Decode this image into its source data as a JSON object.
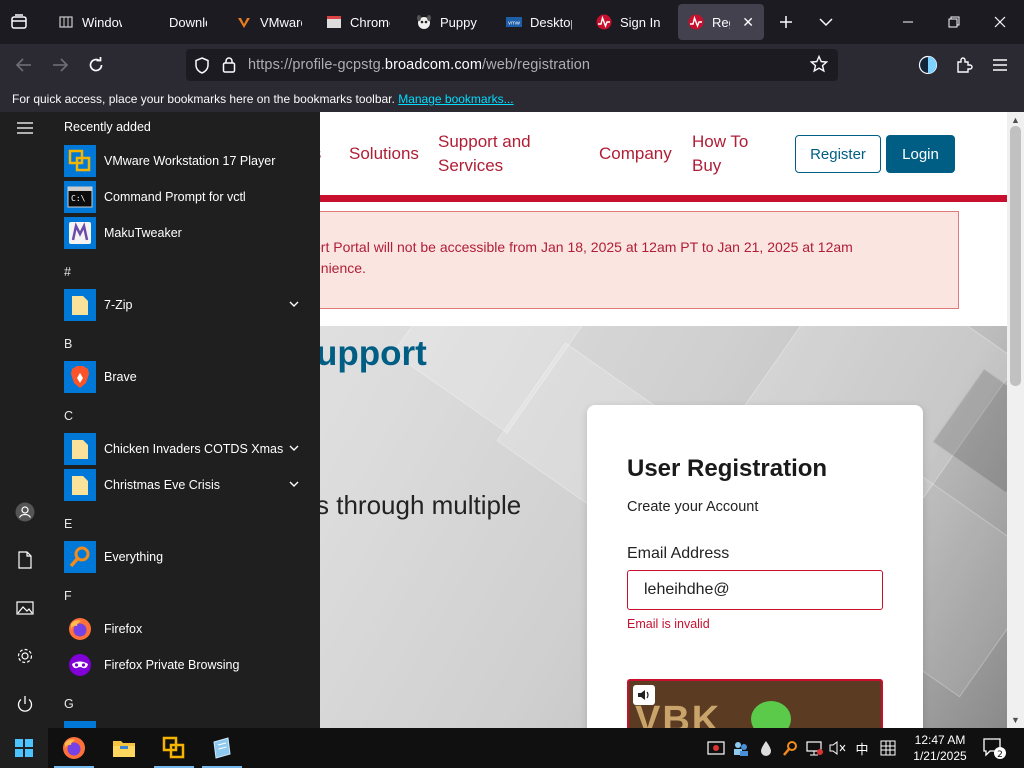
{
  "browser": {
    "tabs": [
      {
        "title": "Window",
        "fav": "windows-icon"
      },
      {
        "title": "Downlo",
        "fav": "download-icon"
      },
      {
        "title": "VMware",
        "fav": "vmware-icon"
      },
      {
        "title": "Chrome",
        "fav": "chrome-icon"
      },
      {
        "title": "Puppy",
        "fav": "puppy-icon"
      },
      {
        "title": "Desktop",
        "fav": "vmware-desktop-icon"
      },
      {
        "title": "Sign In",
        "fav": "broadcom-icon"
      },
      {
        "title": "Regist",
        "fav": "broadcom-icon",
        "active": true
      }
    ],
    "url_prefix": "https://profile-gcpstg.",
    "url_domain": "broadcom.com",
    "url_path": "/web/registration",
    "bookmarks_text": "For quick access, place your bookmarks here on the bookmarks toolbar.",
    "bookmarks_link": "Manage bookmarks..."
  },
  "site": {
    "nav": {
      "partial": "ts",
      "solutions": "Solutions",
      "support_1": "Support and",
      "support_2": "Services",
      "company": "Company",
      "howto_1": "How To",
      "howto_2": "Buy",
      "register": "Register",
      "login": "Login"
    },
    "alert_line1": "ort Portal will not be accessible from Jan 18, 2025 at 12am PT to Jan 21, 2025 at 12am",
    "alert_line2": "enience.",
    "hero_title": "upport",
    "hero_sub": "s through multiple",
    "card": {
      "title": "User Registration",
      "subtitle": "Create your Account",
      "email_label": "Email Address",
      "email_value": "leheihdhe@",
      "email_error": "Email is invalid",
      "captcha_text": "VBK"
    }
  },
  "start_menu": {
    "recently_added": "Recently added",
    "recent": [
      {
        "label": "VMware Workstation 17 Player",
        "icon": "vmware-workstation-icon"
      },
      {
        "label": "Command Prompt for vctl",
        "icon": "command-prompt-icon"
      },
      {
        "label": "MakuTweaker",
        "icon": "makutweaker-icon"
      }
    ],
    "groups": [
      {
        "letter": "#",
        "items": [
          {
            "label": "7-Zip",
            "icon": "folder-icon",
            "expandable": true
          }
        ]
      },
      {
        "letter": "B",
        "items": [
          {
            "label": "Brave",
            "icon": "brave-icon"
          }
        ]
      },
      {
        "letter": "C",
        "items": [
          {
            "label": "Chicken Invaders COTDS Xmas",
            "icon": "folder-icon",
            "expandable": true
          },
          {
            "label": "Christmas Eve Crisis",
            "icon": "folder-icon",
            "expandable": true
          }
        ]
      },
      {
        "letter": "E",
        "items": [
          {
            "label": "Everything",
            "icon": "everything-icon"
          }
        ]
      },
      {
        "letter": "F",
        "items": [
          {
            "label": "Firefox",
            "icon": "firefox-icon"
          },
          {
            "label": "Firefox Private Browsing",
            "icon": "firefox-private-icon"
          }
        ]
      },
      {
        "letter": "G",
        "items": []
      }
    ]
  },
  "taskbar": {
    "time": "12:47 AM",
    "date": "1/21/2025",
    "ime": "中",
    "notifications": "2"
  },
  "colors": {
    "brand_red": "#c8102e",
    "brand_blue": "#005e85",
    "browser_bg": "#1c1b22",
    "start_bg": "#1f1f1f"
  }
}
